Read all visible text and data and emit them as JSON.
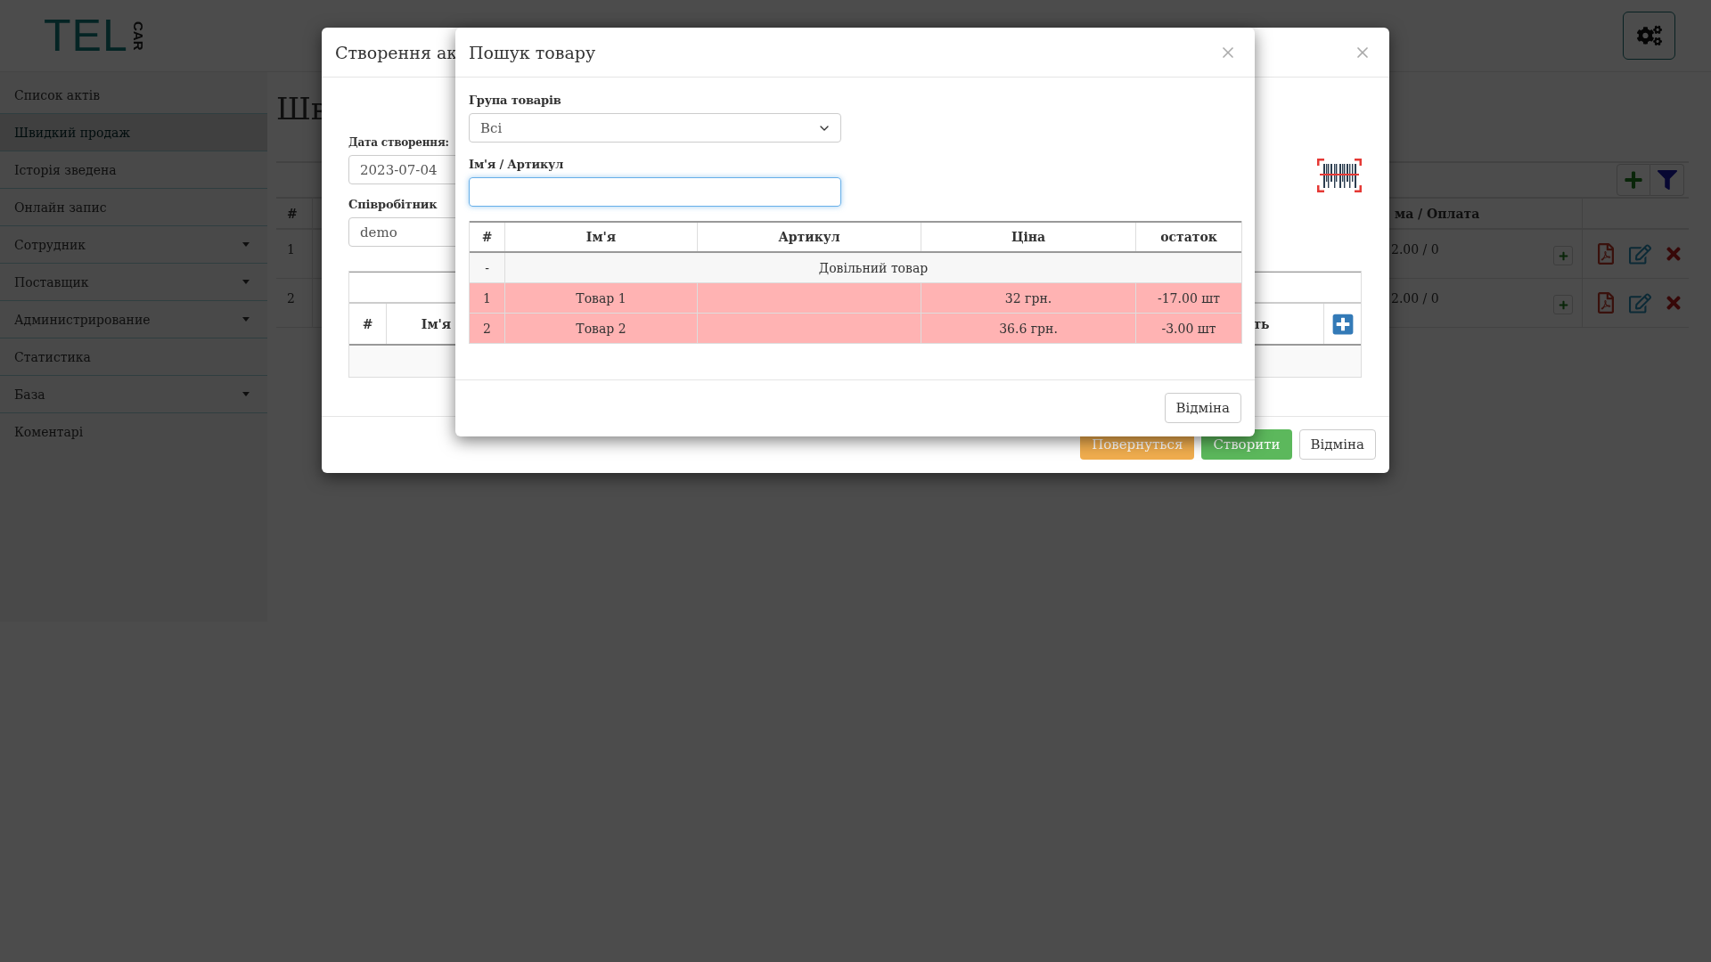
{
  "header": {
    "logo": {
      "main": "TEL",
      "side": "CAR"
    }
  },
  "sidebar": {
    "items": [
      {
        "label": "Список актів",
        "selected": false,
        "has_submenu": false
      },
      {
        "label": "Швидкий продаж",
        "selected": true,
        "has_submenu": false
      },
      {
        "label": "Історія зведена",
        "selected": false,
        "has_submenu": false
      },
      {
        "label": "Онлайн запис",
        "selected": false,
        "has_submenu": false
      },
      {
        "label": "Сотрудник",
        "selected": false,
        "has_submenu": true
      },
      {
        "label": "Поставщик",
        "selected": false,
        "has_submenu": true
      },
      {
        "label": "Администрирование",
        "selected": false,
        "has_submenu": true
      },
      {
        "label": "Статистика",
        "selected": false,
        "has_submenu": false
      },
      {
        "label": "База",
        "selected": false,
        "has_submenu": true
      },
      {
        "label": "Коментарі",
        "selected": false,
        "has_submenu": false
      }
    ]
  },
  "page": {
    "title": "Шв",
    "table": {
      "columns": [
        "#",
        "ма / Оплата"
      ],
      "rows": [
        {
          "number": "1",
          "amount": "2.00 / 0"
        },
        {
          "number": "2",
          "amount": "2.00 / 0"
        }
      ]
    }
  },
  "create_modal": {
    "title": "Створення ак",
    "date_label": "Дата створення:",
    "date_value": "2023-07-04",
    "employee_label": "Співробітник",
    "employee_value": "demo",
    "table": {
      "columns": [
        "#",
        "Ім'я",
        "ть"
      ]
    },
    "buttons": [
      {
        "label": "Повернуться",
        "kind": "warning"
      },
      {
        "label": "Створити",
        "kind": "success"
      },
      {
        "label": "Відміна",
        "kind": "default"
      }
    ]
  },
  "search_modal": {
    "title": "Пошук товару",
    "group_label": "Група товарів",
    "group_value": "Всі",
    "name_label": "Ім'я / Артикул",
    "table": {
      "columns": [
        "#",
        "Ім'я",
        "Артикул",
        "Ціна",
        "остаток"
      ],
      "rows": [
        {
          "kind": "custom",
          "number": "-",
          "name": "Довільний товар",
          "warning": false
        },
        {
          "kind": "item",
          "number": "1",
          "name": "Товар 1",
          "price": "32 грн.",
          "stock": "-17.00 шт",
          "warning": true
        },
        {
          "kind": "item",
          "number": "2",
          "name": "Товар 2",
          "price": "36.6 грн.",
          "stock": "-3.00 шт",
          "warning": true
        }
      ]
    },
    "cancel": "Відміна"
  }
}
